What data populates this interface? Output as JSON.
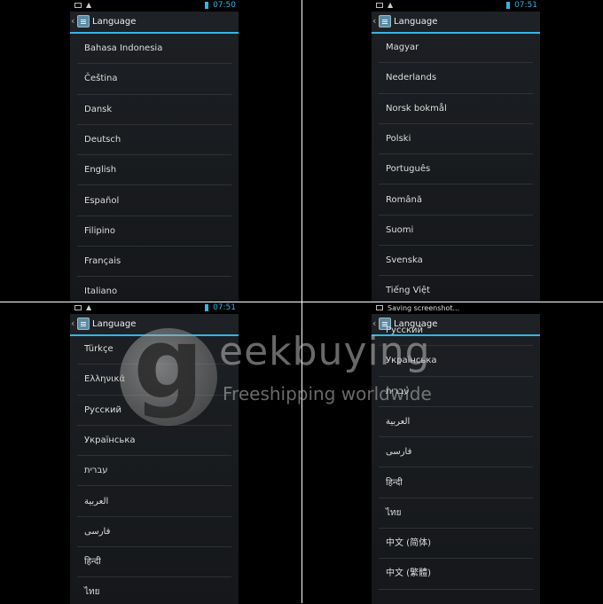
{
  "accent_color": "#33b5e5",
  "screens": [
    {
      "status": {
        "time": "07:50",
        "notification": ""
      },
      "actionbar": {
        "title": "Language"
      },
      "items": [
        "Bahasa Indonesia",
        "Čeština",
        "Dansk",
        "Deutsch",
        "English",
        "Español",
        "Filipino",
        "Français",
        "Italiano"
      ]
    },
    {
      "status": {
        "time": "07:51",
        "notification": ""
      },
      "actionbar": {
        "title": "Language"
      },
      "items": [
        "Magyar",
        "Nederlands",
        "Norsk bokmål",
        "Polski",
        "Português",
        "Română",
        "Suomi",
        "Svenska",
        "Tiếng Việt"
      ]
    },
    {
      "status": {
        "time": "07:51",
        "notification": ""
      },
      "actionbar": {
        "title": "Language"
      },
      "items": [
        "Türkçe",
        "Ελληνικά",
        "Русский",
        "Українська",
        "עברית",
        "العربية",
        "فارسی",
        "हिन्दी",
        "ไทย"
      ]
    },
    {
      "status": {
        "time": "",
        "notification": "Saving screenshot..."
      },
      "actionbar": {
        "title": "Language"
      },
      "items": [
        "Русский",
        "Українська",
        "עברית",
        "العربية",
        "فارسی",
        "हिन्दी",
        "ไทย",
        "中文 (简体)",
        "中文 (繁體)"
      ]
    }
  ],
  "watermark": {
    "letter": "g",
    "word": "eekbuying",
    "subtitle": "Freeshipping worldwide"
  }
}
